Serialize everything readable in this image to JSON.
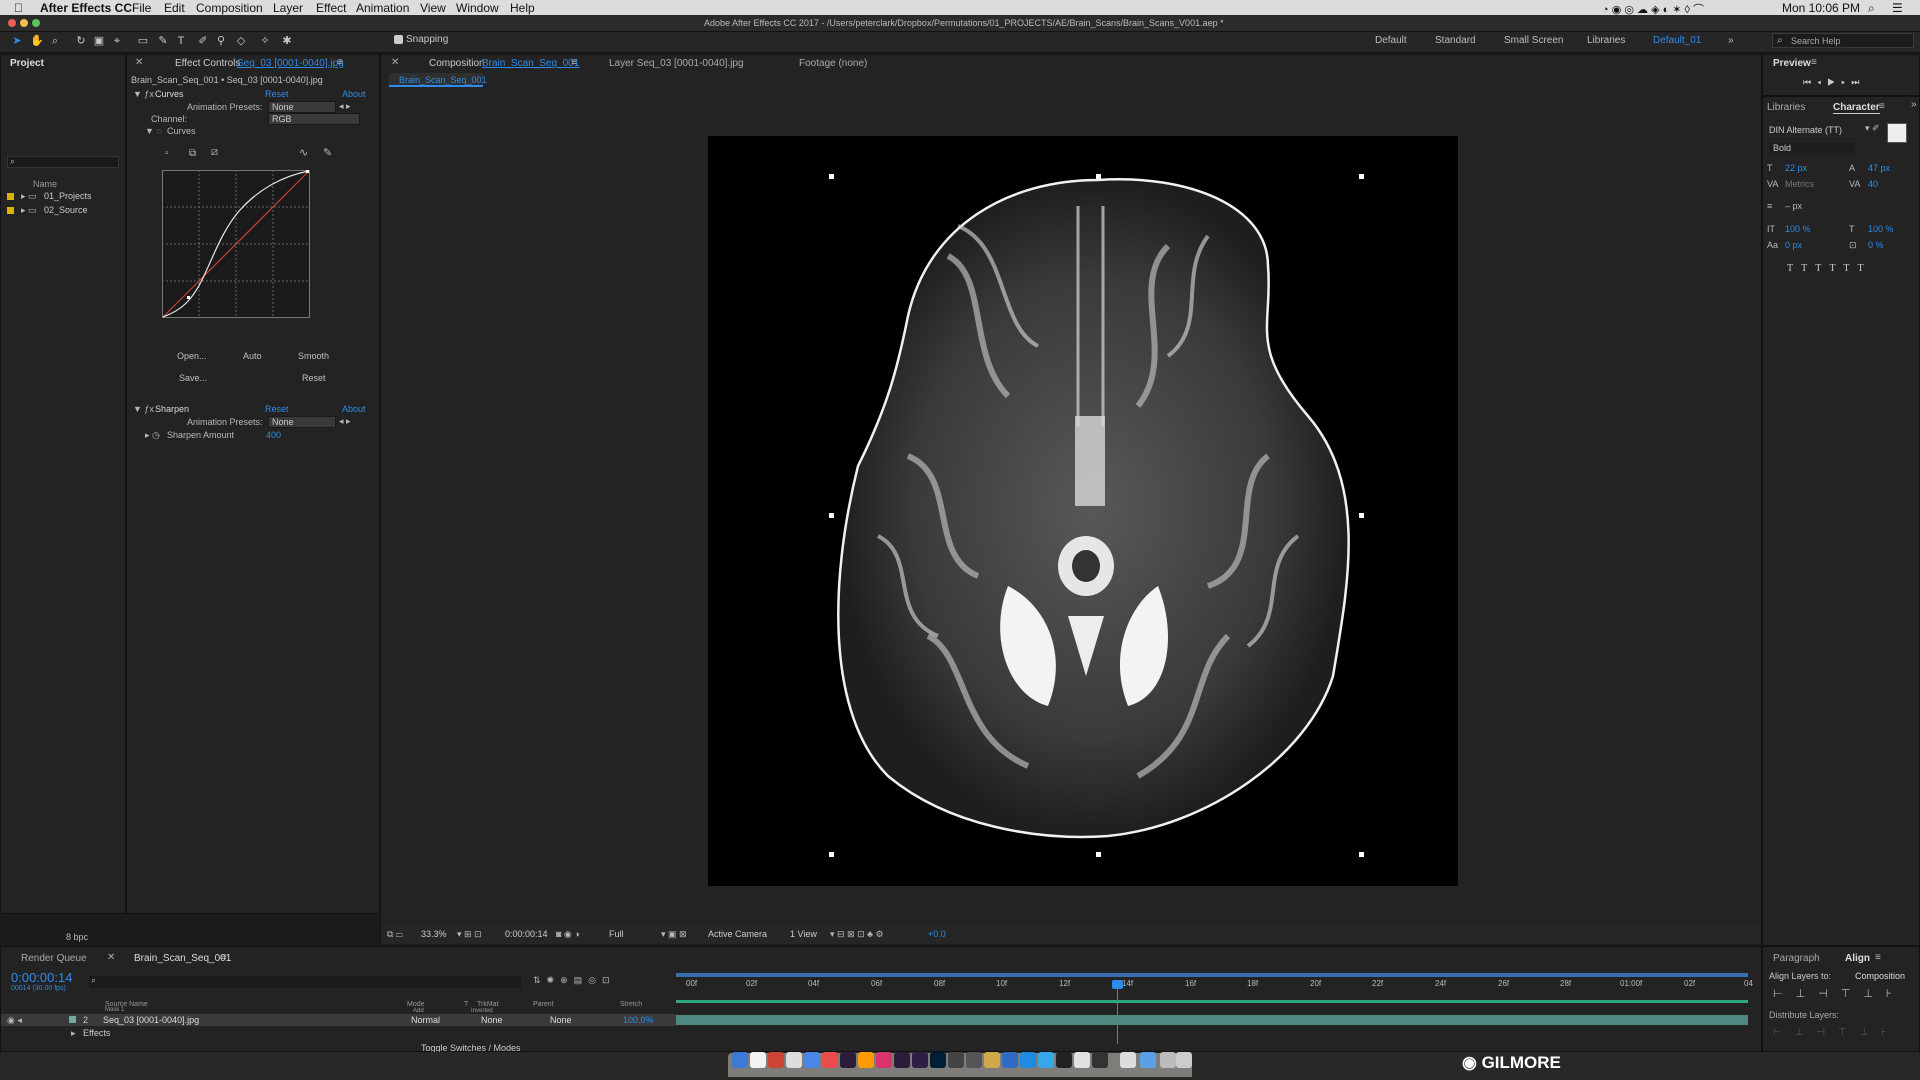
{
  "menubar": {
    "app": "After Effects CC",
    "items": [
      "File",
      "Edit",
      "Composition",
      "Layer",
      "Effect",
      "Animation",
      "View",
      "Window",
      "Help"
    ],
    "time": "Mon 10:06 PM"
  },
  "titlebar": {
    "title": "Adobe After Effects CC 2017 - /Users/peterclark/Dropbox/Permutations/01_PROJECTS/AE/Brain_Scans/Brain_Scans_V001.aep *"
  },
  "toolbar": {
    "snapping": "Snapping",
    "workspaces": [
      "Default",
      "Standard",
      "Small Screen",
      "Libraries",
      "Default_01"
    ],
    "search": "Search Help"
  },
  "project": {
    "title": "Project",
    "col_name": "Name",
    "items": [
      "01_Projects",
      "02_Source"
    ],
    "bpc": "8 bpc"
  },
  "effects": {
    "tab_prefix": "Effect Controls",
    "tab_layer": "Seq_03 [0001-0040].jpg",
    "path": "Brain_Scan_Seq_001 • Seq_03 [0001-0040].jpg",
    "curves": "Curves",
    "reset": "Reset",
    "about": "About",
    "anim_presets": "Animation Presets:",
    "none": "None",
    "channel": "Channel:",
    "rgb": "RGB",
    "curves_sub": "Curves",
    "open": "Open...",
    "auto": "Auto",
    "smooth": "Smooth",
    "save": "Save...",
    "reset2": "Reset",
    "sharpen": "Sharpen",
    "sharpen_amount": "Sharpen Amount",
    "sharpen_value": "400"
  },
  "comp": {
    "tab_prefix": "Composition",
    "tab_name": "Brain_Scan_Seq_001",
    "layer_tab": "Layer Seq_03 [0001-0040].jpg",
    "footage_tab": "Footage (none)",
    "subtab": "Brain_Scan_Seq_001",
    "zoom": "33.3%",
    "timecode": "0:00:00:14",
    "resolution": "Full",
    "camera": "Active Camera",
    "views": "1 View",
    "exposure": "+0.0"
  },
  "preview": {
    "title": "Preview"
  },
  "character": {
    "libraries": "Libraries",
    "title": "Character",
    "font": "DIN Alternate (TT)",
    "style": "Bold",
    "size": "22 px",
    "leading": "47 px",
    "kerning": "Metrics",
    "tracking": "40",
    "stroke": "– px",
    "vscale": "100 %",
    "hscale": "100 %",
    "baseline": "0 px",
    "tsume": "0 %"
  },
  "align": {
    "paragraph": "Paragraph",
    "title": "Align",
    "align_to_label": "Align Layers to:",
    "align_to": "Composition",
    "distribute": "Distribute Layers:"
  },
  "timeline": {
    "render_queue": "Render Queue",
    "comp_tab": "Brain_Scan_Seq_001",
    "timecode": "0:00:00:14",
    "subtime": "00014 (30.00 fps)",
    "cols": [
      "Source Name",
      "Mode",
      "T",
      "TrkMat",
      "Parent",
      "Stretch"
    ],
    "masks": "Mask 1",
    "mask_mode": "Add",
    "inverted": "Inverted",
    "layer_num": "2",
    "layer_name": "Seq_03 [0001-0040].jpg",
    "mode": "Normal",
    "trkmat": "None",
    "parent": "None",
    "stretch": "100.0%",
    "effects": "Effects",
    "toggle": "Toggle Switches / Modes",
    "ticks": [
      "00f",
      "02f",
      "04f",
      "06f",
      "08f",
      "10f",
      "12f",
      "14f",
      "16f",
      "18f",
      "20f",
      "22f",
      "24f",
      "26f",
      "28f",
      "01:00f",
      "02f",
      "04"
    ]
  },
  "watermark": "GILMORE"
}
